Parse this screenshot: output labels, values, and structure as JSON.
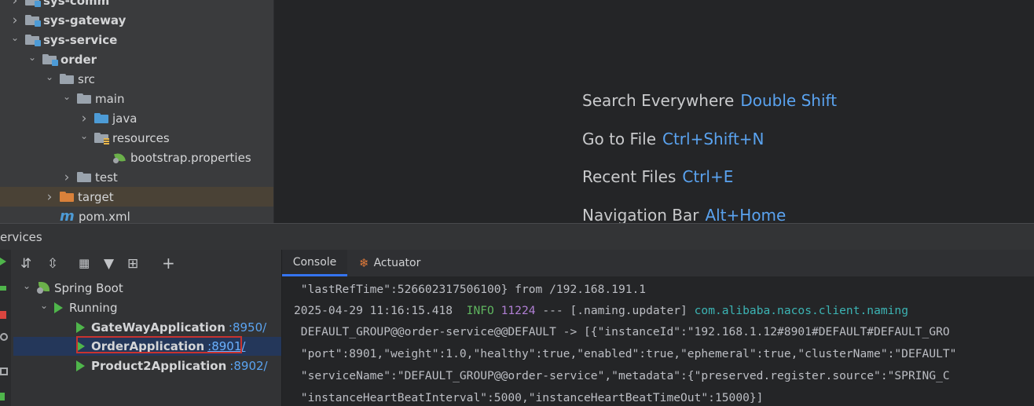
{
  "project_tree": {
    "items": [
      {
        "label": "sys-comm",
        "bold": true
      },
      {
        "label": "sys-gateway",
        "bold": true
      },
      {
        "label": "sys-service",
        "bold": true
      },
      {
        "label": "order",
        "bold": true
      },
      {
        "label": "src"
      },
      {
        "label": "main"
      },
      {
        "label": "java"
      },
      {
        "label": "resources"
      },
      {
        "label": "bootstrap.properties"
      },
      {
        "label": "test"
      },
      {
        "label": "target"
      },
      {
        "label": "pom.xml"
      }
    ]
  },
  "editor_hints": [
    {
      "text": "Search Everywhere",
      "key": "Double Shift"
    },
    {
      "text": "Go to File",
      "key": "Ctrl+Shift+N"
    },
    {
      "text": "Recent Files",
      "key": "Ctrl+E"
    },
    {
      "text": "Navigation Bar",
      "key": "Alt+Home"
    }
  ],
  "services": {
    "title": "ervices",
    "tree": {
      "root": "Spring Boot",
      "group": "Running",
      "apps": [
        {
          "name": "GateWayApplication",
          "port": ":8950/"
        },
        {
          "name": "OrderApplication",
          "port": ":8901/"
        },
        {
          "name": "Product2Application",
          "port": ":8902/"
        }
      ]
    }
  },
  "console": {
    "tabs": [
      "Console",
      "Actuator"
    ],
    "lines": {
      "l1": " \"lastRefTime\":526602317506100} from /192.168.191.1",
      "l2_time": "2025-04-29 11:16:15.418  ",
      "l2_level": "INFO",
      "l2_pid": " 11224",
      "l2_mid": " --- [.naming.updater] ",
      "l2_logger": "com.alibaba.nacos.client.naming",
      "l3": " DEFAULT_GROUP@@order-service@@DEFAULT -> [{\"instanceId\":\"192.168.1.12#8901#DEFAULT#DEFAULT_GRO",
      "l4": " \"port\":8901,\"weight\":1.0,\"healthy\":true,\"enabled\":true,\"ephemeral\":true,\"clusterName\":\"DEFAULT\"",
      "l5": " \"serviceName\":\"DEFAULT_GROUP@@order-service\",\"metadata\":{\"preserved.register.source\":\"SPRING_C",
      "l6": " \"instanceHeartBeatInterval\":5000,\"instanceHeartBeatTimeOut\":15000}]"
    }
  },
  "colors": {
    "accent_link": "#5aa3f0",
    "run_green": "#4fb54b",
    "highlight_red": "#c8332f",
    "selection_blue": "#24375a"
  }
}
